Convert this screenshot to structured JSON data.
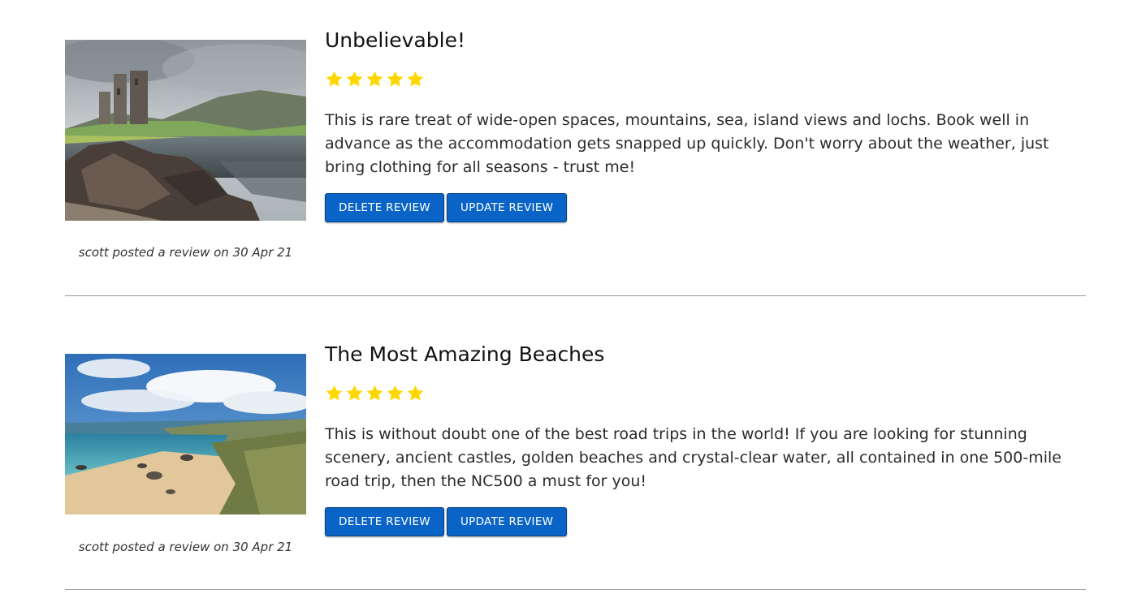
{
  "reviews": [
    {
      "title": "Unbelievable!",
      "rating": 5,
      "rating_max": 5,
      "body": "This is rare treat of wide-open spaces, mountains, sea, island views and lochs. Book well in advance as the accommodation gets snapped up quickly. Don't worry about the weather, just bring clothing for all seasons - trust me!",
      "delete_label": "DELETE REVIEW",
      "update_label": "UPDATE REVIEW",
      "byline": "scott posted a review on 30 Apr 21"
    },
    {
      "title": "The Most Amazing Beaches",
      "rating": 5,
      "rating_max": 5,
      "body": "This is without doubt one of the best road trips in the world! If you are looking for stunning scenery, ancient castles, golden beaches and crystal-clear water, all contained in one 500-mile road trip, then the NC500 a must for you!",
      "delete_label": "DELETE REVIEW",
      "update_label": "UPDATE REVIEW",
      "byline": "scott posted a review on 30 Apr 21"
    }
  ],
  "icons": {
    "star": "star-icon"
  },
  "colors": {
    "button": "#0a64c8",
    "star": "#ffd700",
    "divider": "#9a9a9a"
  }
}
